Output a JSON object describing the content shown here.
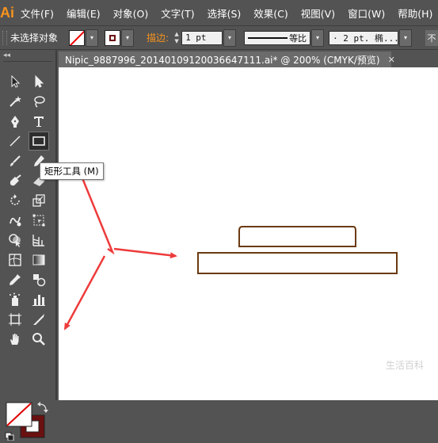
{
  "app": {
    "logo": "Ai"
  },
  "menu": [
    "文件(F)",
    "编辑(E)",
    "对象(O)",
    "文字(T)",
    "选择(S)",
    "效果(C)",
    "视图(V)",
    "窗口(W)",
    "帮助(H)"
  ],
  "control_bar": {
    "selection_status": "未选择对象",
    "stroke_label": "描边:",
    "stroke_weight": "1 pt",
    "stroke_profile": "等比",
    "brush": "· 2 pt. 椭...",
    "trailing_text": "不"
  },
  "document_tab": {
    "title": "Nipic_9887996_20140109120036647111.ai*  @  200%  (CMYK/预览)",
    "close": "✕"
  },
  "tooltip": {
    "text": "矩形工具 (M)"
  },
  "watermark": "生活百科",
  "colors": {
    "rect_stroke": "#6b3a10",
    "arrow": "#ee3b3b",
    "accent": "#f7931e",
    "stroke_swatch": "#6b1010"
  },
  "tools": [
    "selection-icon",
    "direct-selection-icon",
    "magic-wand-icon",
    "lasso-icon",
    "pen-icon",
    "type-icon",
    "line-segment-icon",
    "rectangle-icon",
    "paintbrush-icon",
    "pencil-icon",
    "blob-brush-icon",
    "eraser-icon",
    "rotate-icon",
    "scale-icon",
    "warp-icon",
    "free-transform-icon",
    "shape-builder-icon",
    "perspective-grid-icon",
    "mesh-icon",
    "gradient-icon",
    "eyedropper-icon",
    "blend-icon",
    "symbol-sprayer-icon",
    "column-graph-icon",
    "artboard-icon",
    "slice-icon",
    "hand-icon",
    "zoom-icon"
  ]
}
